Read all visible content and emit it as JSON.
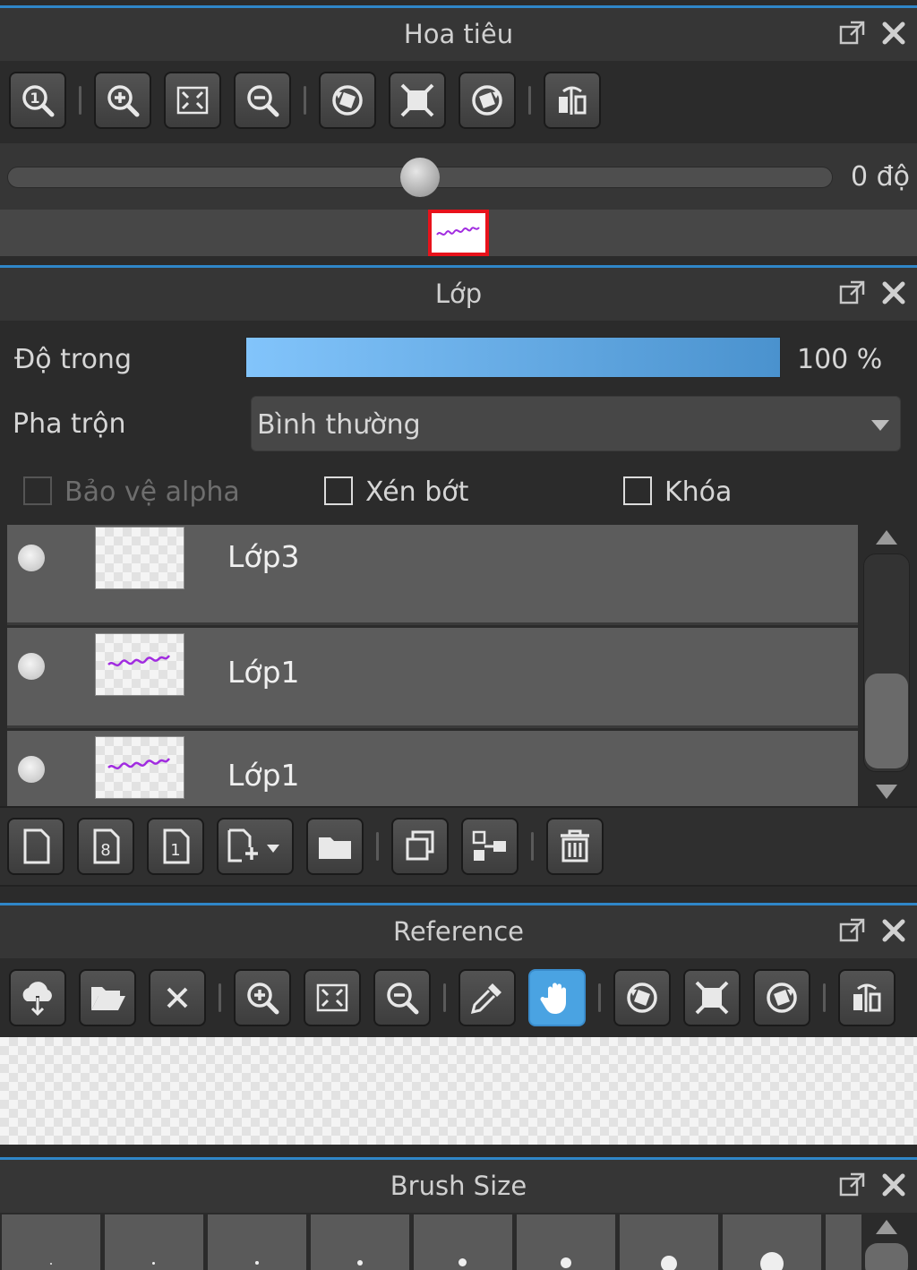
{
  "navigator": {
    "title": "Hoa tiêu",
    "rotation_label": "0 độ",
    "rotation_value": 0,
    "toolbar_icons": [
      "zoom-actual-icon",
      "zoom-in-icon",
      "fit-window-icon",
      "zoom-out-icon",
      "rotate-left-icon",
      "reset-view-icon",
      "rotate-right-icon",
      "flip-horizontal-icon"
    ]
  },
  "layers": {
    "title": "Lớp",
    "opacity_label": "Độ trong",
    "opacity_value": "100 %",
    "opacity_percent": 100,
    "blend_label": "Pha trộn",
    "blend_value": "Bình thường",
    "protect_alpha": "Bảo vệ alpha",
    "clipping": "Xén bớt",
    "lock": "Khóa",
    "items": [
      {
        "name": "Lớp3",
        "has_content": false
      },
      {
        "name": "Lớp1",
        "has_content": true
      },
      {
        "name": "Lớp1",
        "has_content": true
      }
    ],
    "bottom_toolbar_icons": [
      "new-layer-icon",
      "new-8bit-layer-icon",
      "new-1bit-layer-icon",
      "add-layer-dropdown-icon",
      "new-folder-icon",
      "duplicate-layer-icon",
      "merge-down-icon",
      "delete-layer-icon"
    ]
  },
  "reference": {
    "title": "Reference",
    "toolbar_icons": [
      "load-image-icon",
      "open-folder-icon",
      "close-icon",
      "zoom-in-icon",
      "fit-window-icon",
      "zoom-out-icon",
      "eyedropper-icon",
      "hand-tool-icon",
      "rotate-left-icon",
      "reset-view-icon",
      "rotate-right-icon",
      "flip-horizontal-icon"
    ],
    "active_tool": "hand-tool-icon"
  },
  "brush_size": {
    "title": "Brush Size"
  },
  "colors": {
    "accent": "#2f86c8",
    "active_tool": "#4aa3e2",
    "panel_bg": "#2b2b2b",
    "header_bg": "#363636",
    "layer_row_bg": "#5c5c5c"
  }
}
